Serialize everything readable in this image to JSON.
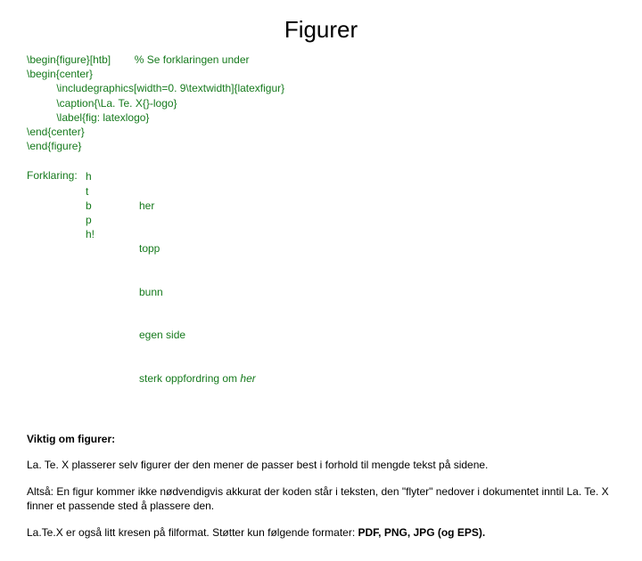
{
  "title": "Figurer",
  "code": "\\begin{figure}[htb]        % Se forklaringen under\n\\begin{center}\n          \\includegraphics[width=0. 9\\textwidth]{latexfigur}\n          \\caption{\\La. Te. X{}-logo}\n          \\label{fig: latexlogo}\n\\end{center}\n\\end{figure}",
  "fk_label": "Forklaring:",
  "fk_codes": "h\nt\nb\np\nh!",
  "fk_mean_0": "her",
  "fk_mean_1": "topp",
  "fk_mean_2": "bunn",
  "fk_mean_3": "egen side",
  "fk_mean_4_a": "sterk oppfordring om ",
  "fk_mean_4_b": "her",
  "important_heading": "Viktig om figurer:",
  "para1": "La. Te. X plasserer selv figurer der den mener de passer best i forhold til mengde tekst på sidene.",
  "para2": "Altså: En figur kommer ikke nødvendigvis akkurat der koden står i teksten, den \"flyter\" nedover i dokumentet inntil La. Te. X finner et passende sted å plassere den.",
  "para3_a": "La.Te.X er også litt kresen på filformat. Støtter kun følgende formater: ",
  "para3_b": "PDF, PNG, JPG (og EPS)."
}
